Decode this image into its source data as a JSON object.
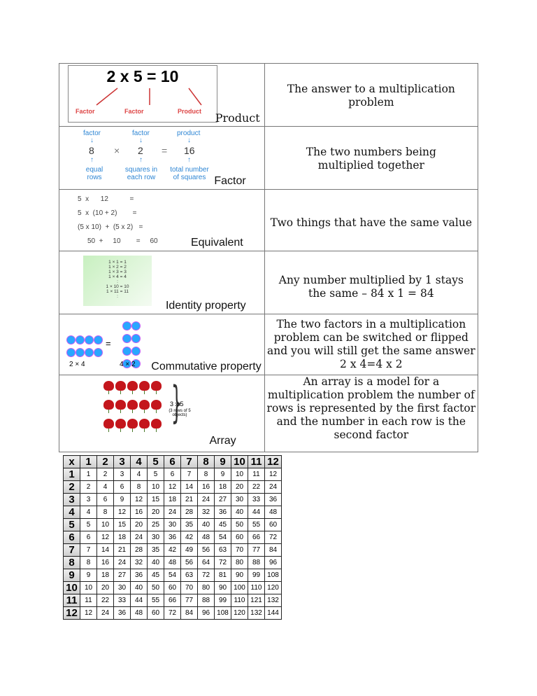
{
  "rows": [
    {
      "term": "Product",
      "definition": "The answer to a multiplication problem",
      "image": {
        "equation": "2 x 5 = 10",
        "labels": [
          "Factor",
          "Factor",
          "Product"
        ]
      }
    },
    {
      "term": "Factor",
      "definition": "The two numbers being multiplied together",
      "image": {
        "top": [
          "factor",
          "factor",
          "product"
        ],
        "numbers": [
          "8",
          "×",
          "2",
          "=",
          "16"
        ],
        "bottom": [
          "equal rows",
          "squares in each row",
          "total number of squares"
        ]
      }
    },
    {
      "term": "Equivalent",
      "definition": "Two things that have the same value",
      "image": {
        "lines": [
          "5  x      12           =",
          "5  x  (10 + 2)        =",
          "(5 x 10)  +  (5 x 2)   =",
          "50  +     10        =     60"
        ]
      }
    },
    {
      "term": "Identity property",
      "definition": "Any number multiplied by 1 stays the same – 84 x 1 = 84",
      "image": {
        "lines": [
          "1 × 1 = 1",
          "1 × 2 = 2",
          "1 × 3 = 3",
          "1 × 4 = 4",
          ":",
          "1 × 10 = 10",
          "1 × 11 = 11",
          ":"
        ]
      }
    },
    {
      "term": "Commutative property",
      "definition": "The two factors in a multiplication problem can be switched or flipped and you will still get the same answer 2 x 4=4 x 2",
      "image": {
        "left_label": "2 × 4",
        "equals": "=",
        "right_label": "4 × 2"
      }
    },
    {
      "term": "Array",
      "definition": "An array is a model for a multiplication problem the number of rows is represented by the first factor and the number in each row is the second factor",
      "image": {
        "caption": "3 x 5",
        "sub": "(3 rows of 5 objects)"
      }
    }
  ],
  "times_table": {
    "corner": "x",
    "headers": [
      1,
      2,
      3,
      4,
      5,
      6,
      7,
      8,
      9,
      10,
      11,
      12
    ],
    "rows": [
      [
        1,
        2,
        3,
        4,
        5,
        6,
        7,
        8,
        9,
        10,
        11,
        12
      ],
      [
        2,
        4,
        6,
        8,
        10,
        12,
        14,
        16,
        18,
        20,
        22,
        24
      ],
      [
        3,
        6,
        9,
        12,
        15,
        18,
        21,
        24,
        27,
        30,
        33,
        36
      ],
      [
        4,
        8,
        12,
        16,
        20,
        24,
        28,
        32,
        36,
        40,
        44,
        48
      ],
      [
        5,
        10,
        15,
        20,
        25,
        30,
        35,
        40,
        45,
        50,
        55,
        60
      ],
      [
        6,
        12,
        18,
        24,
        30,
        36,
        42,
        48,
        54,
        60,
        66,
        72
      ],
      [
        7,
        14,
        21,
        28,
        35,
        42,
        49,
        56,
        63,
        70,
        77,
        84
      ],
      [
        8,
        16,
        24,
        32,
        40,
        48,
        56,
        64,
        72,
        80,
        88,
        96
      ],
      [
        9,
        18,
        27,
        36,
        45,
        54,
        63,
        72,
        81,
        90,
        99,
        108
      ],
      [
        10,
        20,
        30,
        40,
        50,
        60,
        70,
        80,
        90,
        100,
        110,
        120
      ],
      [
        11,
        22,
        33,
        44,
        55,
        66,
        77,
        88,
        99,
        110,
        121,
        132
      ],
      [
        12,
        24,
        36,
        48,
        60,
        72,
        84,
        96,
        108,
        120,
        132,
        144
      ]
    ]
  }
}
